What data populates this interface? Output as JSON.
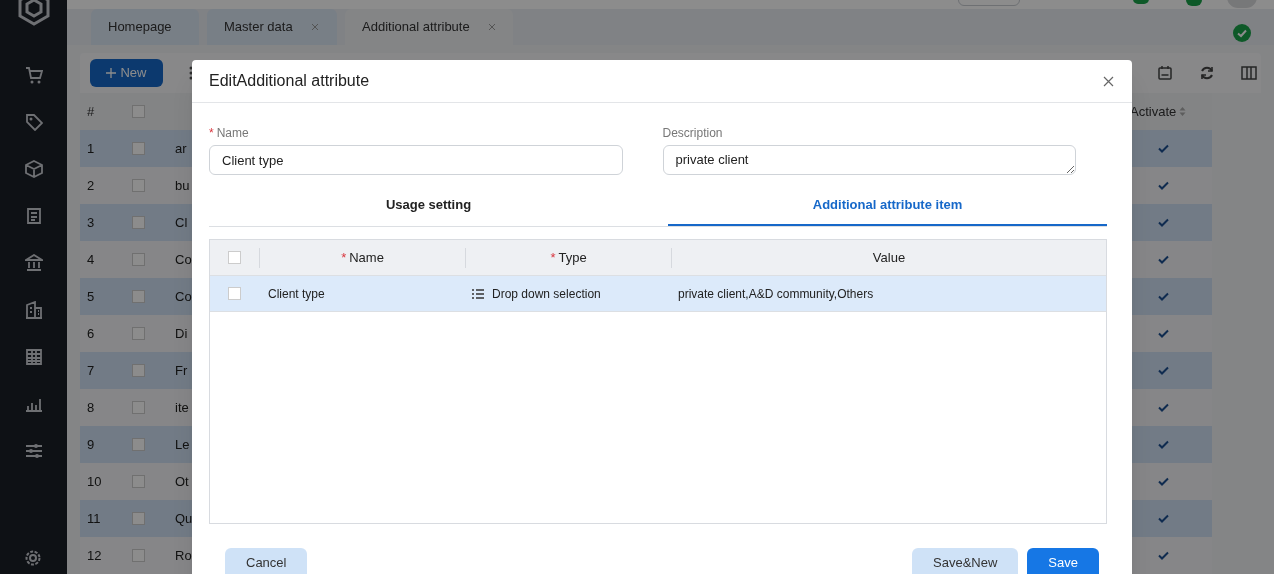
{
  "tabs": [
    {
      "label": "Homepage",
      "closable": false,
      "selected": false
    },
    {
      "label": "Master data",
      "closable": true,
      "selected": false
    },
    {
      "label": "Additional attribute",
      "closable": true,
      "selected": true
    }
  ],
  "toolbar": {
    "new_button": "New"
  },
  "table": {
    "columns": [
      "#",
      "Activate"
    ],
    "header_checked": false,
    "rows": [
      {
        "index": "1",
        "name": "ar",
        "checked": false,
        "activate": true
      },
      {
        "index": "2",
        "name": "bu",
        "checked": false,
        "activate": true
      },
      {
        "index": "3",
        "name": "Cl",
        "checked": false,
        "activate": true
      },
      {
        "index": "4",
        "name": "Co",
        "checked": false,
        "activate": true
      },
      {
        "index": "5",
        "name": "Co",
        "checked": false,
        "activate": true
      },
      {
        "index": "6",
        "name": "Di",
        "checked": false,
        "activate": true
      },
      {
        "index": "7",
        "name": "Fr",
        "checked": false,
        "activate": true
      },
      {
        "index": "8",
        "name": "ite",
        "checked": false,
        "activate": true
      },
      {
        "index": "9",
        "name": "Le",
        "checked": false,
        "activate": true
      },
      {
        "index": "10",
        "name": "Ot",
        "checked": false,
        "activate": true
      },
      {
        "index": "11",
        "name": "Qu",
        "checked": false,
        "activate": true
      },
      {
        "index": "12",
        "name": "Ro",
        "checked": false,
        "activate": true
      }
    ]
  },
  "dialog": {
    "title": "EditAdditional attribute",
    "fields": [
      {
        "label": "Name",
        "required_mark": "*",
        "value": "Client type",
        "kind": "input"
      },
      {
        "label": "Description",
        "value": "private client",
        "kind": "textarea"
      }
    ],
    "tabs": [
      {
        "label": "Usage setting",
        "selected": false
      },
      {
        "label": "Additional attribute item",
        "selected": true
      }
    ],
    "item_table": {
      "header_checked": false,
      "columns": [
        {
          "label": "Name",
          "required_mark": "*"
        },
        {
          "label": "Type",
          "required_mark": "*"
        },
        {
          "label": "Value"
        }
      ],
      "rows": [
        {
          "name": "Client type",
          "type": "Drop down selection",
          "value": "private client,A&D community,Others",
          "checked": false,
          "selected": true
        }
      ]
    },
    "buttons": [
      {
        "label": "Cancel",
        "kind": "secondary"
      },
      {
        "label": "Save&New",
        "kind": "secondary"
      },
      {
        "label": "Save",
        "kind": "primary"
      }
    ]
  }
}
